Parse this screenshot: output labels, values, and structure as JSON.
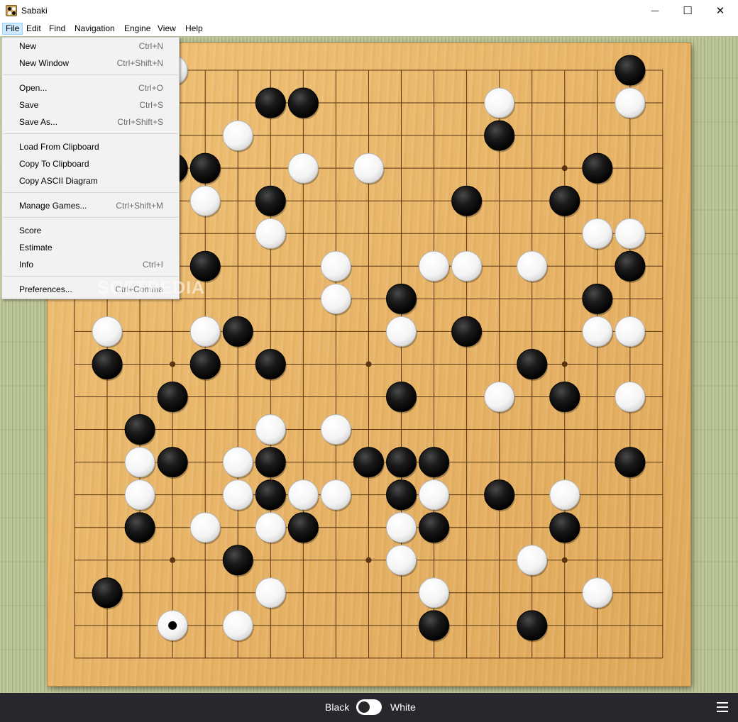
{
  "window": {
    "title": "Sabaki",
    "controls": {
      "minimize": "—",
      "maximize": "☐",
      "close": "✕"
    },
    "icons": [
      "sabaki-app-icon",
      "minimize-icon",
      "maximize-icon",
      "close-icon"
    ]
  },
  "menubar": {
    "items": [
      "File",
      "Edit",
      "Find",
      "Navigation",
      "Engine",
      "View",
      "Help"
    ],
    "active": "File"
  },
  "file_menu": {
    "groups": [
      [
        {
          "label": "New",
          "accel": "Ctrl+N"
        },
        {
          "label": "New Window",
          "accel": "Ctrl+Shift+N"
        }
      ],
      [
        {
          "label": "Open...",
          "accel": "Ctrl+O"
        },
        {
          "label": "Save",
          "accel": "Ctrl+S"
        },
        {
          "label": "Save As...",
          "accel": "Ctrl+Shift+S"
        }
      ],
      [
        {
          "label": "Load From Clipboard",
          "accel": ""
        },
        {
          "label": "Copy To Clipboard",
          "accel": ""
        },
        {
          "label": "Copy ASCII Diagram",
          "accel": ""
        }
      ],
      [
        {
          "label": "Manage Games...",
          "accel": "Ctrl+Shift+M"
        }
      ],
      [
        {
          "label": "Score",
          "accel": ""
        },
        {
          "label": "Estimate",
          "accel": ""
        },
        {
          "label": "Info",
          "accel": "Ctrl+I"
        }
      ],
      [
        {
          "label": "Preferences...",
          "accel": "Ctrl+Comma"
        }
      ]
    ]
  },
  "board": {
    "size": 19,
    "hoshi": [
      [
        3,
        3
      ],
      [
        9,
        3
      ],
      [
        15,
        3
      ],
      [
        3,
        9
      ],
      [
        9,
        9
      ],
      [
        15,
        9
      ],
      [
        3,
        15
      ],
      [
        9,
        15
      ],
      [
        15,
        15
      ]
    ],
    "last_move": [
      3,
      17
    ],
    "colors": {
      "line": "#5a3410",
      "black_stone": "#1a1a1a",
      "white_stone": "#f4f4f4"
    },
    "stones": [
      {
        "c": 3,
        "r": 0,
        "color": "W"
      },
      {
        "c": 17,
        "r": 0,
        "color": "B"
      },
      {
        "c": 6,
        "r": 1,
        "color": "B"
      },
      {
        "c": 7,
        "r": 1,
        "color": "B"
      },
      {
        "c": 13,
        "r": 1,
        "color": "W"
      },
      {
        "c": 17,
        "r": 1,
        "color": "W"
      },
      {
        "c": 5,
        "r": 2,
        "color": "W"
      },
      {
        "c": 13,
        "r": 2,
        "color": "B"
      },
      {
        "c": 3,
        "r": 3,
        "color": "B"
      },
      {
        "c": 4,
        "r": 3,
        "color": "B"
      },
      {
        "c": 7,
        "r": 3,
        "color": "W"
      },
      {
        "c": 9,
        "r": 3,
        "color": "W"
      },
      {
        "c": 16,
        "r": 3,
        "color": "B"
      },
      {
        "c": 4,
        "r": 4,
        "color": "W"
      },
      {
        "c": 6,
        "r": 4,
        "color": "B"
      },
      {
        "c": 12,
        "r": 4,
        "color": "B"
      },
      {
        "c": 15,
        "r": 4,
        "color": "B"
      },
      {
        "c": 6,
        "r": 5,
        "color": "W"
      },
      {
        "c": 16,
        "r": 5,
        "color": "W"
      },
      {
        "c": 17,
        "r": 5,
        "color": "W"
      },
      {
        "c": 4,
        "r": 6,
        "color": "B"
      },
      {
        "c": 8,
        "r": 6,
        "color": "W"
      },
      {
        "c": 11,
        "r": 6,
        "color": "W"
      },
      {
        "c": 12,
        "r": 6,
        "color": "W"
      },
      {
        "c": 14,
        "r": 6,
        "color": "W"
      },
      {
        "c": 17,
        "r": 6,
        "color": "B"
      },
      {
        "c": 8,
        "r": 7,
        "color": "W"
      },
      {
        "c": 10,
        "r": 7,
        "color": "B"
      },
      {
        "c": 16,
        "r": 7,
        "color": "B"
      },
      {
        "c": 1,
        "r": 8,
        "color": "W"
      },
      {
        "c": 4,
        "r": 8,
        "color": "W"
      },
      {
        "c": 5,
        "r": 8,
        "color": "B"
      },
      {
        "c": 10,
        "r": 8,
        "color": "W"
      },
      {
        "c": 12,
        "r": 8,
        "color": "B"
      },
      {
        "c": 16,
        "r": 8,
        "color": "W"
      },
      {
        "c": 17,
        "r": 8,
        "color": "W"
      },
      {
        "c": 1,
        "r": 9,
        "color": "B"
      },
      {
        "c": 4,
        "r": 9,
        "color": "B"
      },
      {
        "c": 6,
        "r": 9,
        "color": "B"
      },
      {
        "c": 14,
        "r": 9,
        "color": "B"
      },
      {
        "c": 3,
        "r": 10,
        "color": "B"
      },
      {
        "c": 10,
        "r": 10,
        "color": "B"
      },
      {
        "c": 13,
        "r": 10,
        "color": "W"
      },
      {
        "c": 15,
        "r": 10,
        "color": "B"
      },
      {
        "c": 17,
        "r": 10,
        "color": "W"
      },
      {
        "c": 2,
        "r": 11,
        "color": "B"
      },
      {
        "c": 6,
        "r": 11,
        "color": "W"
      },
      {
        "c": 8,
        "r": 11,
        "color": "W"
      },
      {
        "c": 2,
        "r": 12,
        "color": "W"
      },
      {
        "c": 3,
        "r": 12,
        "color": "B"
      },
      {
        "c": 5,
        "r": 12,
        "color": "W"
      },
      {
        "c": 6,
        "r": 12,
        "color": "B"
      },
      {
        "c": 9,
        "r": 12,
        "color": "B"
      },
      {
        "c": 10,
        "r": 12,
        "color": "B"
      },
      {
        "c": 11,
        "r": 12,
        "color": "B"
      },
      {
        "c": 17,
        "r": 12,
        "color": "B"
      },
      {
        "c": 2,
        "r": 13,
        "color": "W"
      },
      {
        "c": 5,
        "r": 13,
        "color": "W"
      },
      {
        "c": 6,
        "r": 13,
        "color": "B"
      },
      {
        "c": 7,
        "r": 13,
        "color": "W"
      },
      {
        "c": 8,
        "r": 13,
        "color": "W"
      },
      {
        "c": 10,
        "r": 13,
        "color": "B"
      },
      {
        "c": 11,
        "r": 13,
        "color": "W"
      },
      {
        "c": 13,
        "r": 13,
        "color": "B"
      },
      {
        "c": 15,
        "r": 13,
        "color": "W"
      },
      {
        "c": 2,
        "r": 14,
        "color": "B"
      },
      {
        "c": 4,
        "r": 14,
        "color": "W"
      },
      {
        "c": 6,
        "r": 14,
        "color": "W"
      },
      {
        "c": 7,
        "r": 14,
        "color": "B"
      },
      {
        "c": 10,
        "r": 14,
        "color": "W"
      },
      {
        "c": 11,
        "r": 14,
        "color": "B"
      },
      {
        "c": 15,
        "r": 14,
        "color": "B"
      },
      {
        "c": 5,
        "r": 15,
        "color": "B"
      },
      {
        "c": 10,
        "r": 15,
        "color": "W"
      },
      {
        "c": 14,
        "r": 15,
        "color": "W"
      },
      {
        "c": 1,
        "r": 16,
        "color": "B"
      },
      {
        "c": 6,
        "r": 16,
        "color": "W"
      },
      {
        "c": 11,
        "r": 16,
        "color": "W"
      },
      {
        "c": 16,
        "r": 16,
        "color": "W"
      },
      {
        "c": 3,
        "r": 17,
        "color": "W"
      },
      {
        "c": 5,
        "r": 17,
        "color": "W"
      },
      {
        "c": 11,
        "r": 17,
        "color": "B"
      },
      {
        "c": 14,
        "r": 17,
        "color": "B"
      }
    ]
  },
  "statusbar": {
    "black_label": "Black",
    "white_label": "White",
    "current_player": "Black",
    "menu_icon": "hamburger-menu-icon"
  },
  "watermark": "SOFTPEDIA"
}
